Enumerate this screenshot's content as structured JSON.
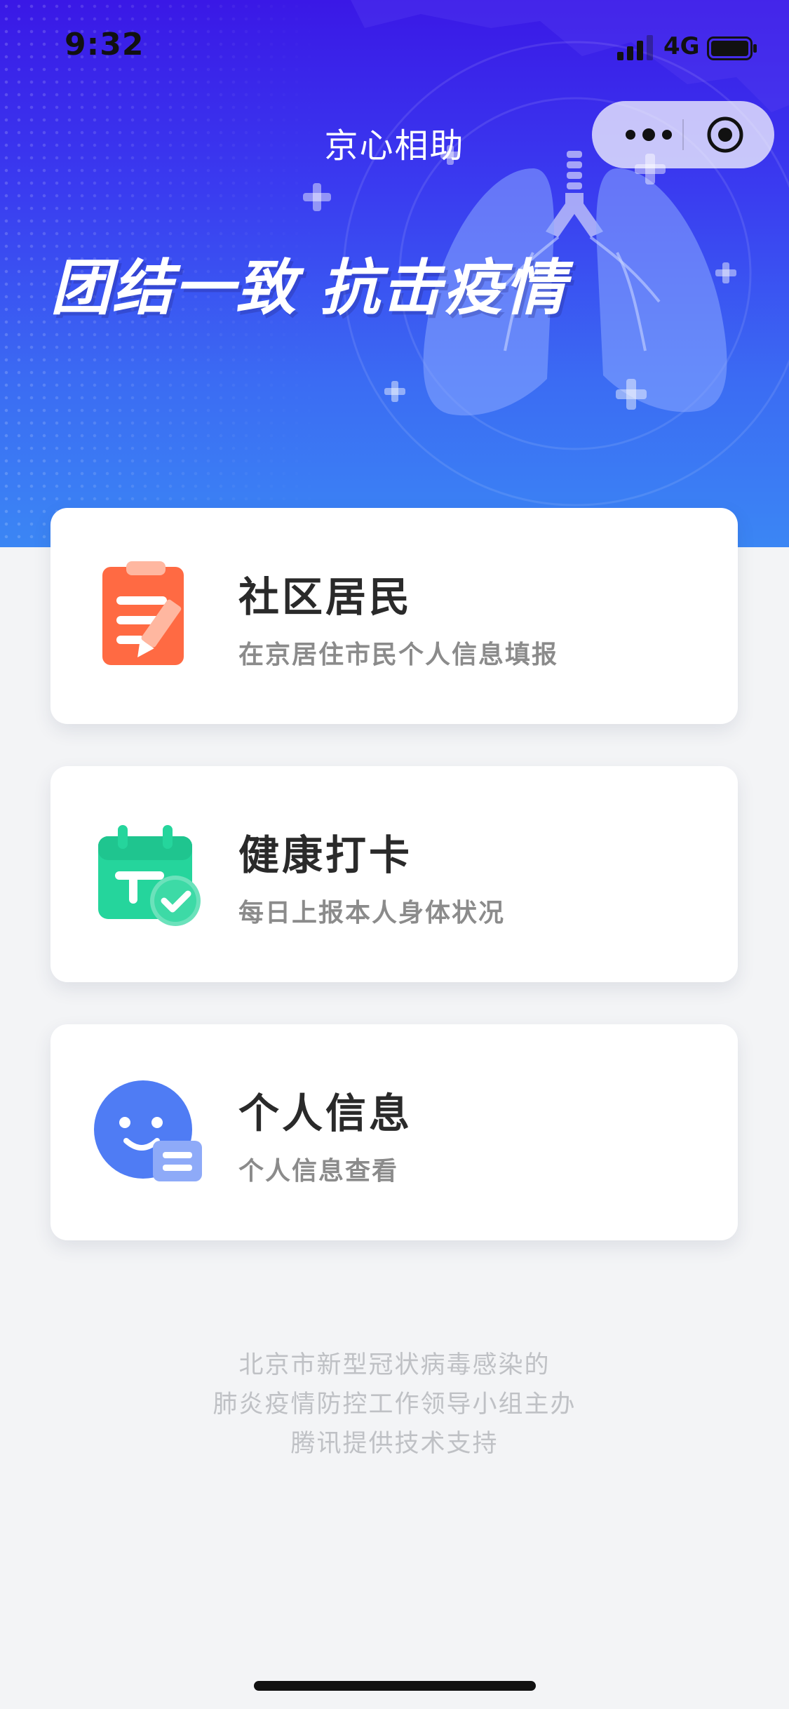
{
  "status_bar": {
    "time": "9:32",
    "network": "4G",
    "signal_icon": "cellular-signal-icon",
    "battery_icon": "battery-icon"
  },
  "header": {
    "title": "京心相助",
    "more_icon": "more-dots-icon",
    "close_icon": "target-close-icon"
  },
  "hero": {
    "slogan": "团结一致 抗击疫情"
  },
  "cards": [
    {
      "title": "社区居民",
      "subtitle": "在京居住市民个人信息填报",
      "icon": "clipboard-edit-icon",
      "accent": "#ff6a43"
    },
    {
      "title": "健康打卡",
      "subtitle": "每日上报本人身体状况",
      "icon": "calendar-check-icon",
      "accent": "#25d59c"
    },
    {
      "title": "个人信息",
      "subtitle": "个人信息查看",
      "icon": "smiley-profile-icon",
      "accent": "#4f7cf4"
    }
  ],
  "footer": {
    "line1": "北京市新型冠状病毒感染的",
    "line2": "肺炎疫情防控工作领导小组主办",
    "line3": "腾讯提供技术支持"
  },
  "colors": {
    "hero_top": "#3a18e6",
    "hero_bottom": "#3b86f4",
    "page_bg": "#f3f4f6",
    "title_text": "#2a2a2a",
    "subtitle_text": "#8b8b8b",
    "footer_text": "#bfc1c5"
  }
}
